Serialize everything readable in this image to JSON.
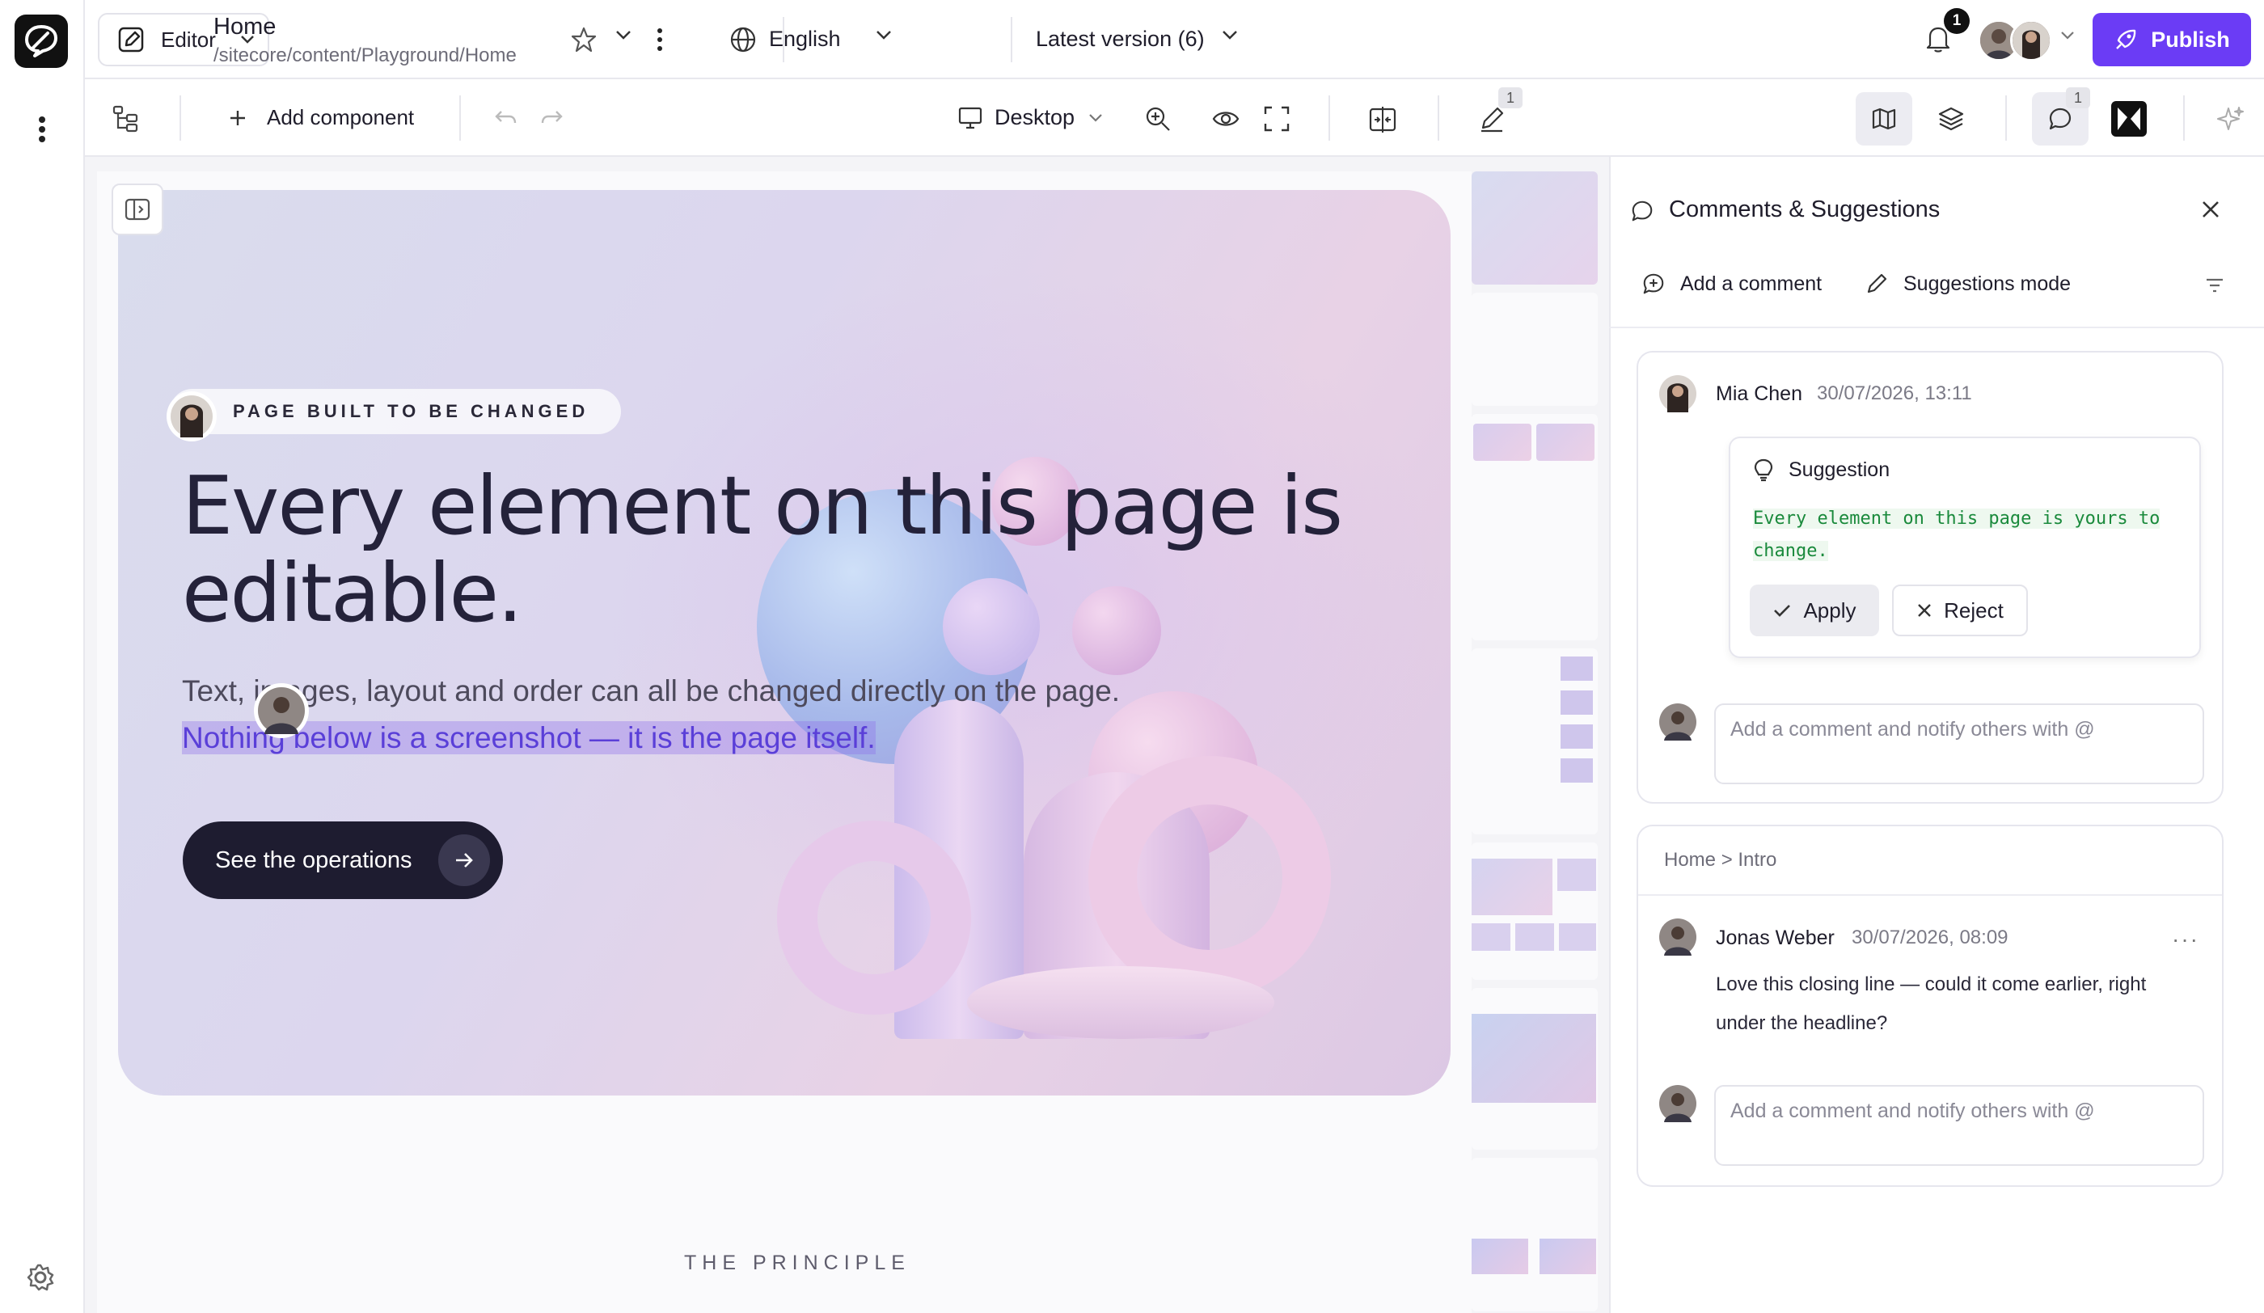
{
  "topbar": {
    "mode_label": "Editor",
    "page_title": "Home",
    "page_path": "/sitecore/content/Playground/Home",
    "language": "English",
    "version": "Latest version (6)",
    "notifications_count": "1",
    "publish_label": "Publish"
  },
  "toolbar": {
    "add_component": "Add component",
    "device": "Desktop",
    "edits_count": "1",
    "comments_count": "1"
  },
  "hero": {
    "badge": "PAGE BUILT TO BE CHANGED",
    "headline": "Every element on this page is editable.",
    "sub_start": "Text, images, layout and order can all be changed directly on the page. ",
    "sub_highlight": "Nothing below is a screenshot — it is the page itself.",
    "cta": "See the operations",
    "next_section": "THE PRINCIPLE"
  },
  "panel": {
    "title": "Comments & Suggestions",
    "add_comment": "Add a comment",
    "suggestions_mode": "Suggestions mode",
    "thread1": {
      "author": "Mia Chen",
      "date": "30/07/2026, 13:11",
      "suggestion_label": "Suggestion",
      "suggestion_text": "Every element on this page is yours to change.",
      "apply": "Apply",
      "reject": "Reject",
      "reply_placeholder": "Add a comment and notify others with @"
    },
    "thread2": {
      "breadcrumb": "Home > Intro",
      "author": "Jonas Weber",
      "date": "30/07/2026, 08:09",
      "body": "Love this closing line — could it come earlier, right under the headline?",
      "more": "···",
      "reply_placeholder": "Add a comment and notify others with @"
    }
  },
  "colors": {
    "accent": "#6b3cf5",
    "dark": "#1e1c30",
    "suggestion_text": "#1a8a3c",
    "highlight": "#8c6eeb"
  }
}
